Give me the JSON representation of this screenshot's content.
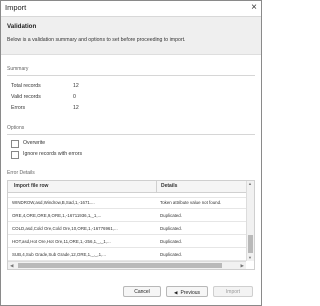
{
  "window": {
    "title": "Import",
    "close_glyph": "×"
  },
  "header": {
    "title": "Validation",
    "subtitle": "Below is a validation summary and options to set before proceeding to import."
  },
  "summary": {
    "section_label": "Summary",
    "items": [
      {
        "label": "Total records",
        "value": "12"
      },
      {
        "label": "Valid records",
        "value": "0"
      },
      {
        "label": "Errors",
        "value": "12"
      }
    ]
  },
  "options": {
    "section_label": "Options",
    "overwrite_label": "Overwrite",
    "overwrite_checked": false,
    "ignore_label": "Ignore records with errors",
    "ignore_checked": false
  },
  "error_details": {
    "section_label": "Error Details",
    "columns": [
      "Import file row",
      "Details"
    ],
    "rows": [
      {
        "row": "WINDROW,asd,Windrow,B,Sad,1,-1671....",
        "details": "Token attribute value not found."
      },
      {
        "row": "ORE,4,ORE,ORE,9,ORE,1,-16711936,1,_1,...",
        "details": "Duplicated."
      },
      {
        "row": "COLD,asd,Cold Ore,Cold Ore,10,ORE,1,-16776961,...",
        "details": "Duplicated."
      },
      {
        "row": "HOT,asd,Hot Ore,Hot Ore,11,ORE,1,-256,1,_,_1,...",
        "details": "Duplicated."
      },
      {
        "row": "SUB,4,Sub Grade,Sub Grade,12,ORE,1,_,_,1,...",
        "details": "Duplicated."
      }
    ]
  },
  "buttons": {
    "cancel": "Cancel",
    "previous": "Previous",
    "import": "Import"
  },
  "icons": {
    "previous": "triangle-left-icon",
    "scroll_up": "triangle-up-icon",
    "scroll_down": "triangle-down-icon",
    "scroll_left": "triangle-left-icon",
    "scroll_right": "triangle-right-icon"
  }
}
